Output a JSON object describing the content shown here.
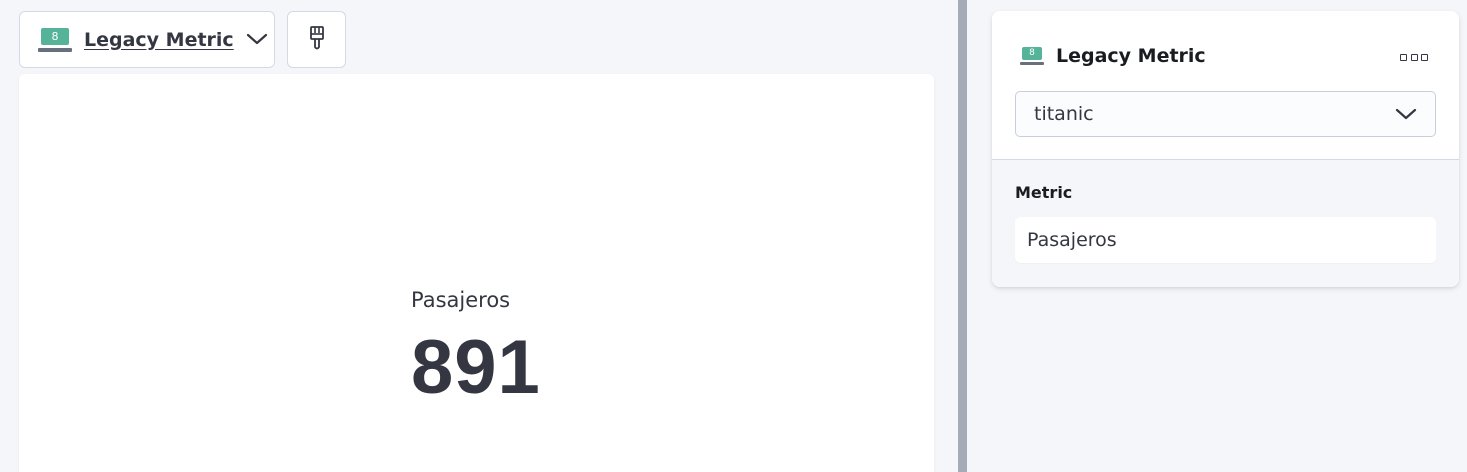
{
  "visualization_switcher": {
    "label": "Legacy Metric",
    "icon": "legacy-metric-icon",
    "icon_digit": "8",
    "chevron_icon": "chevron-down-icon"
  },
  "toolbar": {
    "style_button_icon": "paintbrush-icon"
  },
  "metric_display": {
    "label": "Pasajeros",
    "value": "891"
  },
  "config_panel": {
    "title": "Legacy Metric",
    "icon": "legacy-metric-icon",
    "icon_digit": "8",
    "more_icon": "more-actions-icon",
    "layer_select": {
      "value": "titanic"
    },
    "metric_section": {
      "label": "Metric",
      "dimension": "Pasajeros"
    }
  },
  "colors": {
    "accent_green": "#54b399",
    "text": "#343741",
    "background": "#f5f6fa",
    "divider": "#a5acb8"
  }
}
